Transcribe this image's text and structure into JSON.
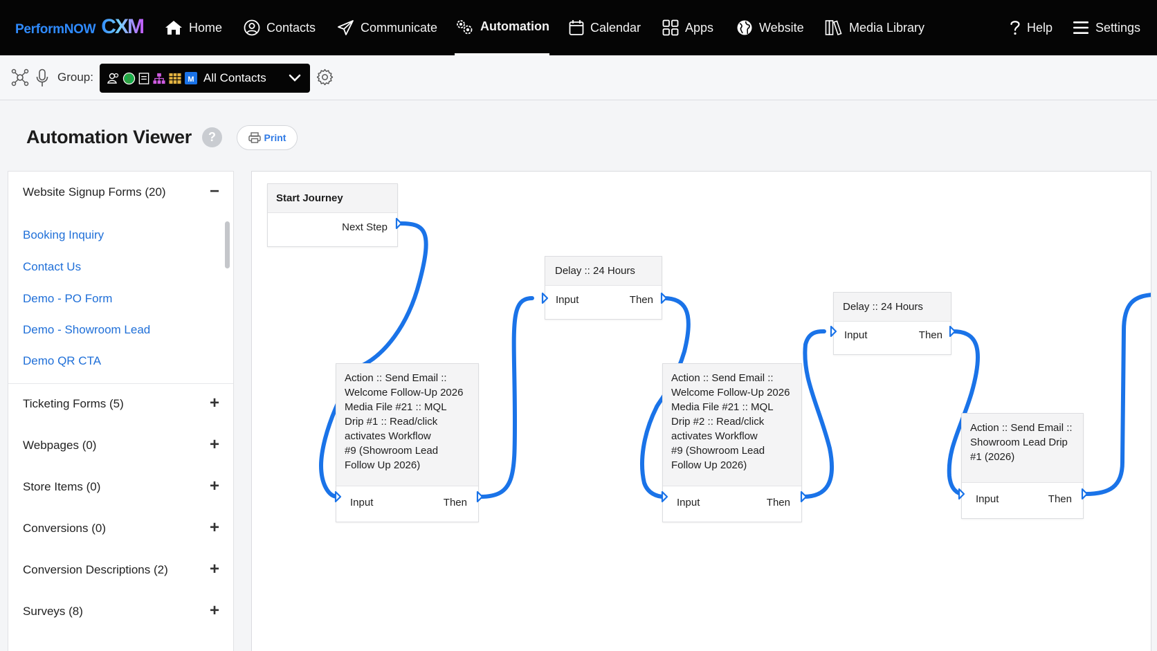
{
  "brand": {
    "name": "PerformNOW",
    "suffix": "CXM"
  },
  "nav": {
    "home": "Home",
    "contacts": "Contacts",
    "communicate": "Communicate",
    "automation": "Automation",
    "calendar": "Calendar",
    "apps": "Apps",
    "website": "Website",
    "media_library": "Media Library",
    "help": "Help",
    "settings": "Settings",
    "active": "Automation"
  },
  "toolbar": {
    "group_label": "Group:",
    "group_value": "All Contacts"
  },
  "page": {
    "title": "Automation Viewer",
    "help_badge": "?",
    "print_label": "Print"
  },
  "sidebar": {
    "sections": [
      {
        "label": "Website Signup Forms (20)",
        "toggle": "−",
        "expanded": true,
        "items": [
          "Booking Inquiry",
          "Contact Us",
          "Demo - PO Form",
          "Demo - Showroom Lead",
          "Demo QR CTA"
        ]
      },
      {
        "label": "Ticketing Forms (5)",
        "toggle": "+"
      },
      {
        "label": "Webpages (0)",
        "toggle": "+"
      },
      {
        "label": "Store Items (0)",
        "toggle": "+"
      },
      {
        "label": "Conversions (0)",
        "toggle": "+"
      },
      {
        "label": "Conversion Descriptions (2)",
        "toggle": "+"
      },
      {
        "label": "Surveys (8)",
        "toggle": "+"
      }
    ]
  },
  "flow": {
    "start": {
      "title": "Start Journey",
      "out": "Next Step"
    },
    "nodes": [
      {
        "lines": [
          "Action :: Send Email ::",
          "Welcome Follow-Up 2026",
          "Media File #21 :: MQL",
          "Drip #1 :: Read/click",
          "activates Workflow",
          "#9 (Showroom Lead",
          "Follow Up 2026)"
        ],
        "in": "Input",
        "out": "Then"
      },
      {
        "lines": [
          "Delay :: 24 Hours"
        ],
        "in": "Input",
        "out": "Then"
      },
      {
        "lines": [
          "Action :: Send Email ::",
          "Welcome Follow-Up 2026",
          "Media File #21 :: MQL",
          "Drip #2 :: Read/click",
          "activates Workflow",
          "#9 (Showroom Lead",
          "Follow Up 2026)"
        ],
        "in": "Input",
        "out": "Then"
      },
      {
        "lines": [
          "Delay :: 24 Hours"
        ],
        "in": "Input",
        "out": "Then"
      },
      {
        "lines": [
          "Action :: Send Email ::",
          "Showroom Lead Drip",
          "#1 (2026)"
        ],
        "in": "Input",
        "out": "Then"
      }
    ]
  },
  "colors": {
    "accent": "#1a73e8",
    "wire": "#1a73e8",
    "nav_bg": "#050505",
    "link": "#1f6fd8"
  },
  "icons": [
    "home-icon",
    "contacts-icon",
    "paper-plane-icon",
    "gears-icon",
    "calendar-icon",
    "apps-grid-icon",
    "globe-icon",
    "books-icon",
    "question-icon",
    "hamburger-icon",
    "network-icon",
    "microphone-icon",
    "chevron-down-icon",
    "gear-icon",
    "printer-icon"
  ]
}
